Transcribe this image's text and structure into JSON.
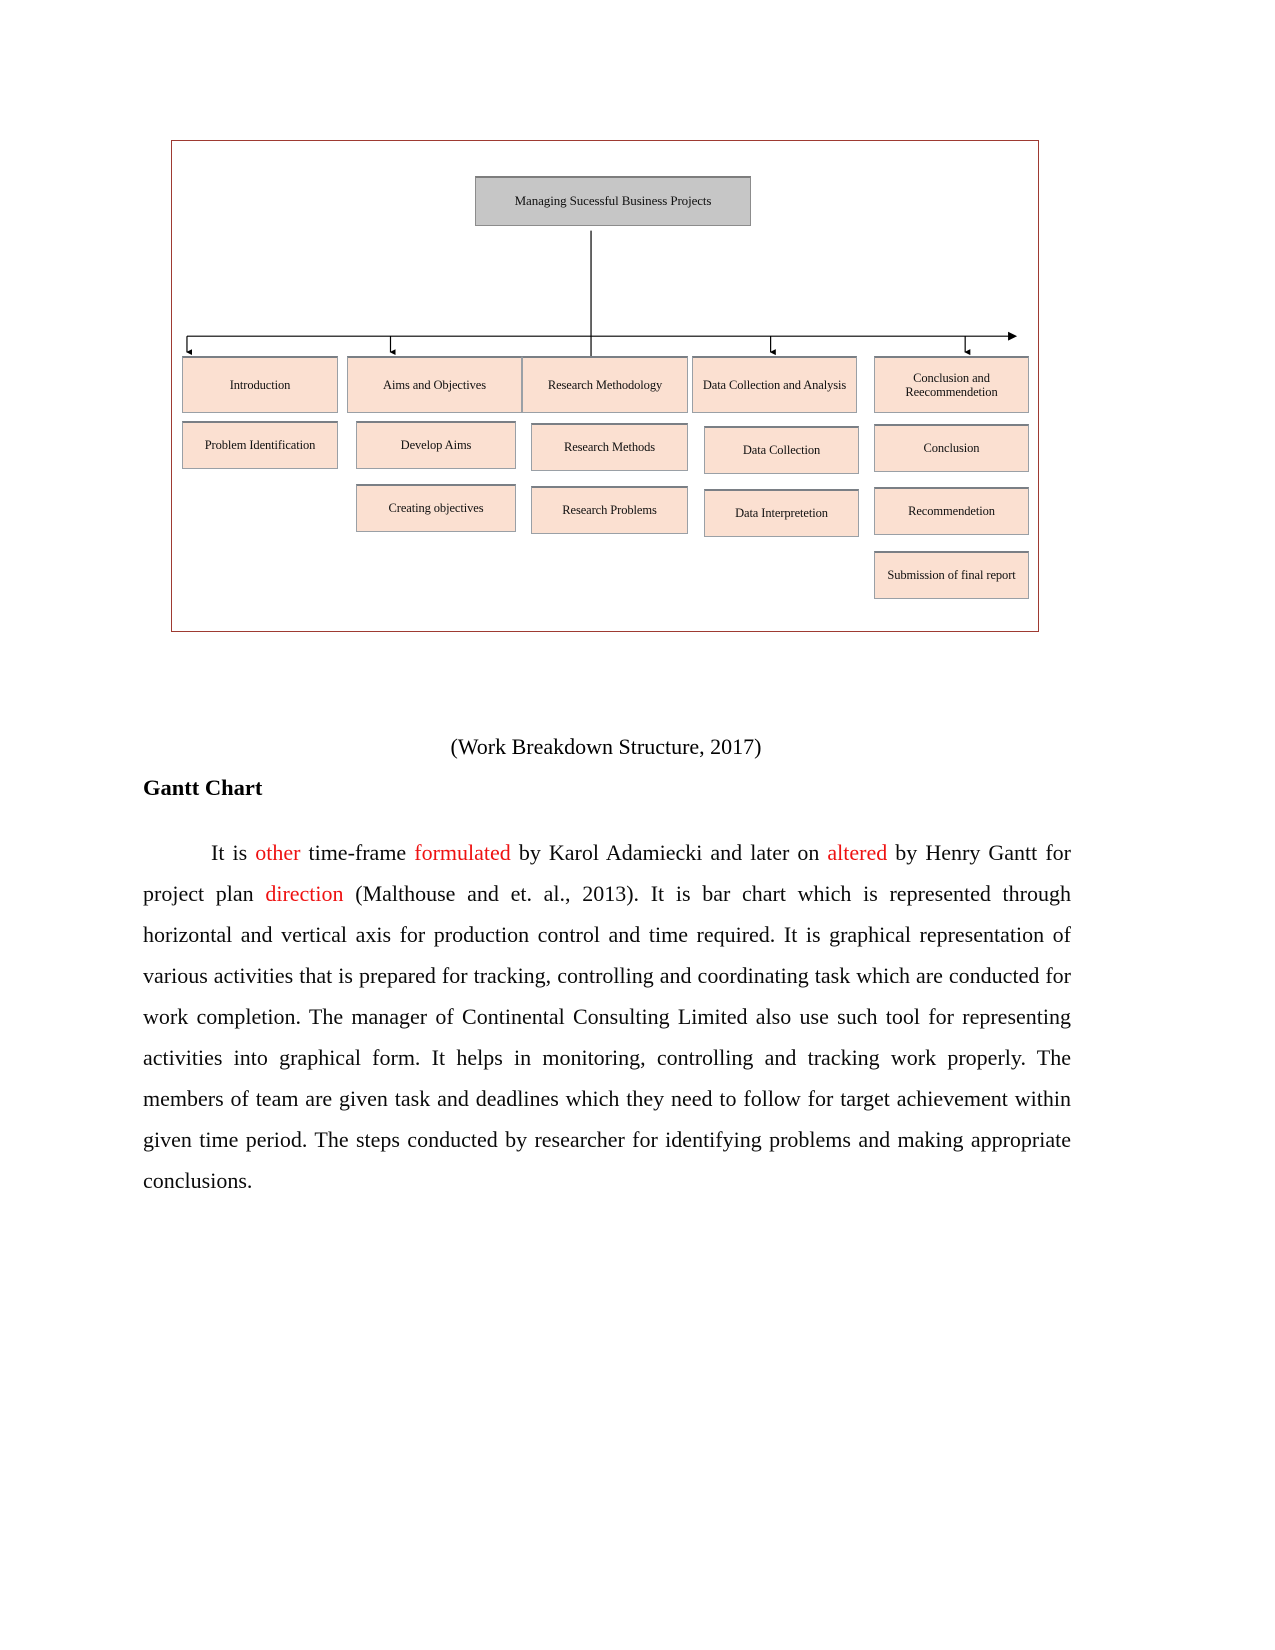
{
  "figure": {
    "frame_color": "#9e3a32",
    "root": {
      "label": "Managing Sucessful Business Projects",
      "fill": "#c6c6c6"
    },
    "node_fill": "#fbe0d1",
    "columns": [
      {
        "header": "Introduction",
        "children": [
          "Problem Identification"
        ]
      },
      {
        "header": "Aims and Objectives",
        "children": [
          "Develop Aims",
          "Creating objectives"
        ]
      },
      {
        "header": "Research Methodology",
        "children": [
          "Research Methods",
          "Research Problems"
        ]
      },
      {
        "header": "Data Collection and Analysis",
        "children": [
          "Data Collection",
          "Data Interpretetion"
        ]
      },
      {
        "header": "Conclusion and Reecommendetion",
        "children": [
          "Conclusion",
          "Recommendetion",
          "Submission of final report"
        ]
      }
    ]
  },
  "caption": "(Work Breakdown Structure, 2017)",
  "heading": "Gantt Chart",
  "paragraph": {
    "segments": [
      {
        "text": "It is ",
        "color": "black"
      },
      {
        "text": "other",
        "color": "red"
      },
      {
        "text": " time-frame ",
        "color": "black"
      },
      {
        "text": "formulated",
        "color": "red"
      },
      {
        "text": " by Karol Adamiecki and later on ",
        "color": "black"
      },
      {
        "text": "altered",
        "color": "red"
      },
      {
        "text": " by Henry Gantt for project plan ",
        "color": "black"
      },
      {
        "text": "direction",
        "color": "red"
      },
      {
        "text": " (Malthouse and et. al.,  2013). It is bar chart which is represented through horizontal and vertical axis for production control and time required. It is graphical representation of various activities that is prepared for tracking, controlling and coordinating task which are conducted for work completion. The manager of Continental Consulting Limited also use such tool for representing activities into graphical form. It helps in monitoring, controlling and tracking work properly. The members of team are given task and deadlines which they need to follow for target achievement within given time period. The steps conducted by researcher for identifying problems and making appropriate conclusions.",
        "color": "black"
      }
    ]
  }
}
